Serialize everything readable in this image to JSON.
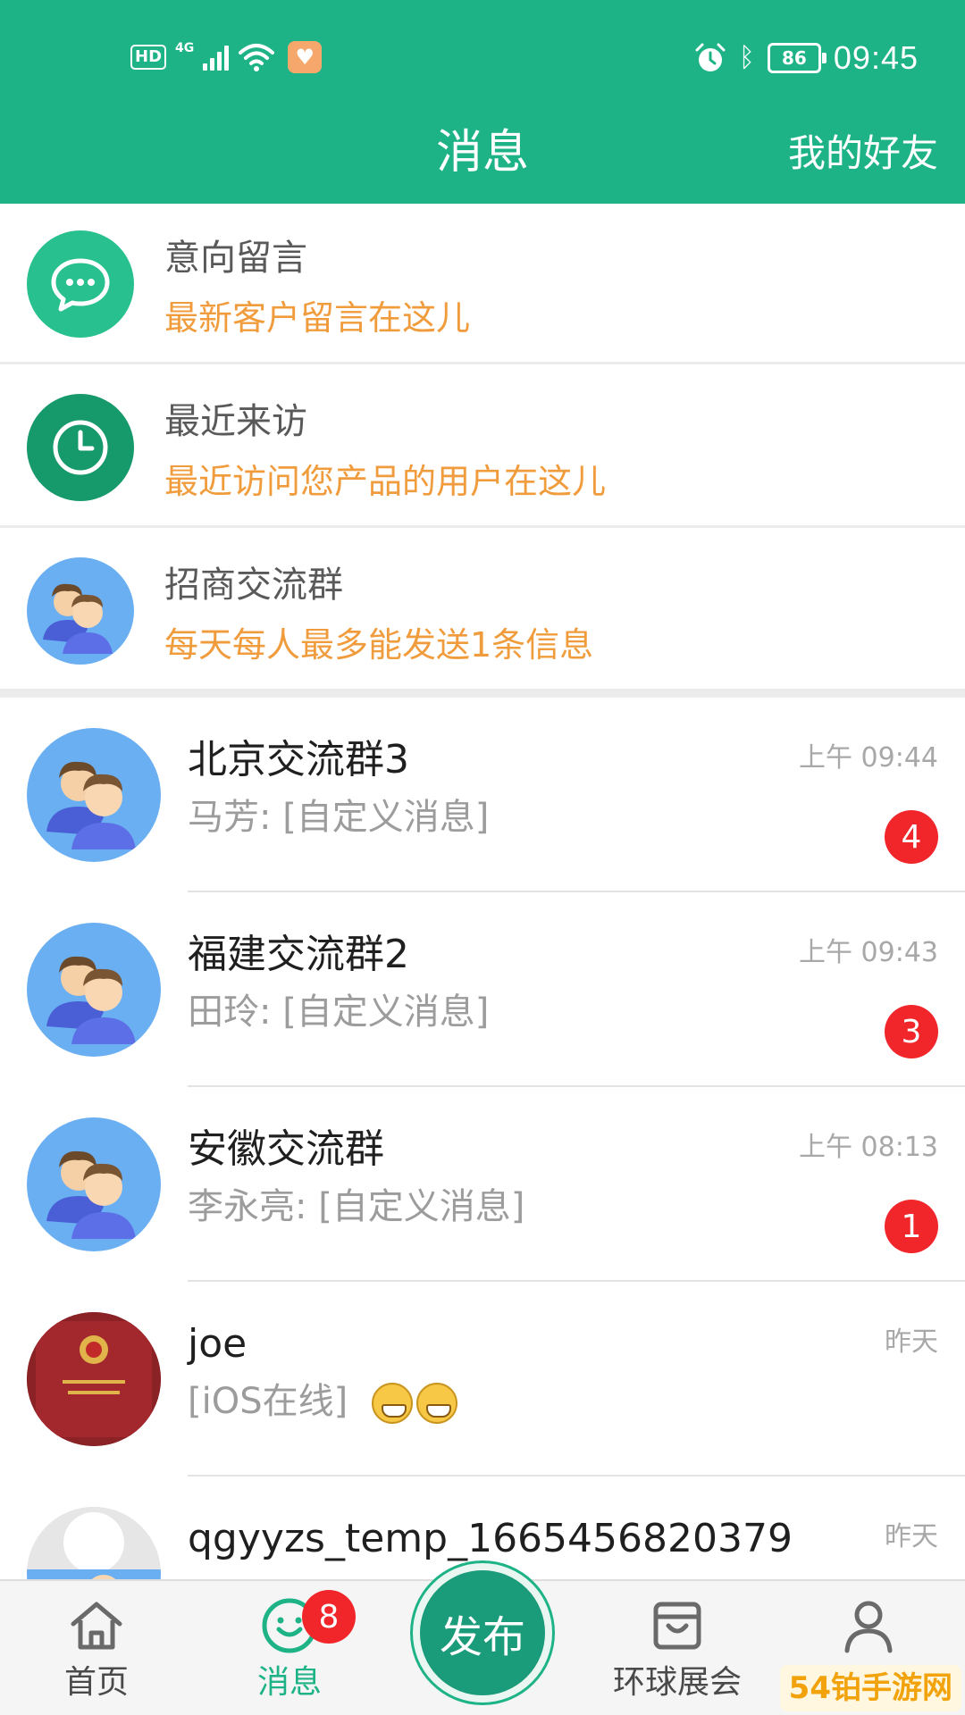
{
  "status_bar": {
    "hd": "HD",
    "network": "4G",
    "battery": "86",
    "time": "09:45"
  },
  "header": {
    "title": "消息",
    "friends_link": "我的好友"
  },
  "features": [
    {
      "title": "意向留言",
      "subtitle": "最新客户留言在这儿",
      "icon": "chat-bubble-icon",
      "color": "#28c08e"
    },
    {
      "title": "最近来访",
      "subtitle": "最近访问您产品的用户在这儿",
      "icon": "clock-icon",
      "color": "#16996b"
    },
    {
      "title": "招商交流群",
      "subtitle": "每天每人最多能发送1条信息",
      "icon": "group-icon",
      "color": "#6aaff2"
    }
  ],
  "chats": [
    {
      "name": "北京交流群3",
      "message": "马芳: [自定义消息]",
      "time": "上午 09:44",
      "badge": "4"
    },
    {
      "name": "福建交流群2",
      "message": "田玲: [自定义消息]",
      "time": "上午 09:43",
      "badge": "3"
    },
    {
      "name": "安徽交流群",
      "message": "李永亮: [自定义消息]",
      "time": "上午 08:13",
      "badge": "1"
    },
    {
      "name": "joe",
      "message": "[iOS在线]",
      "time": "昨天",
      "badge": ""
    },
    {
      "name": "qgyyzs_temp_1665456820379",
      "message": "",
      "time": "昨天",
      "badge": ""
    }
  ],
  "nav": {
    "home": "首页",
    "messages": "消息",
    "messages_badge": "8",
    "publish": "发布",
    "expo": "环球展会",
    "me": "我的"
  },
  "watermark": "54铂手游网",
  "colors": {
    "brand": "#1db386",
    "accent_orange": "#f19c3c",
    "badge_red": "#f1262b"
  }
}
